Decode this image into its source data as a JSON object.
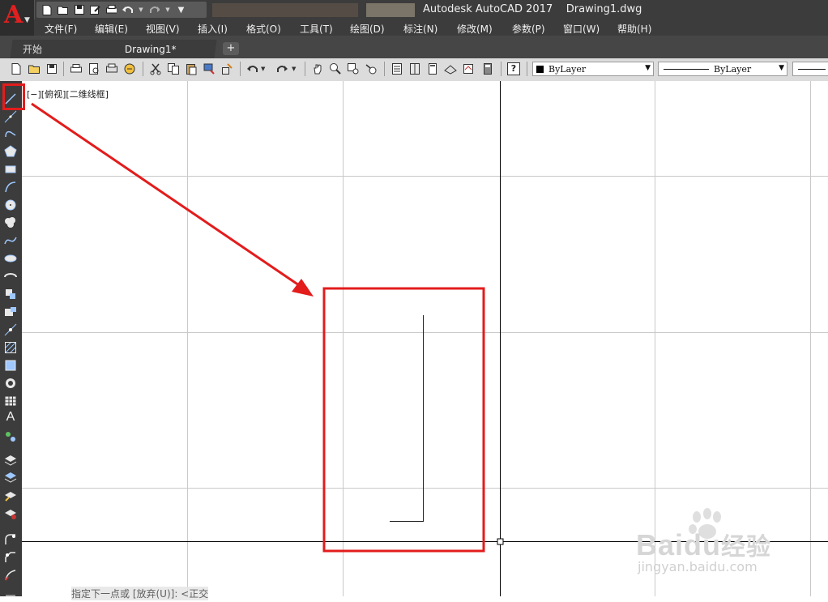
{
  "titlebar": {
    "app_name": "Autodesk AutoCAD 2017",
    "document": "Drawing1.dwg",
    "app_logo_letter": "A",
    "qat_icons": [
      "new-icon",
      "open-icon",
      "save-icon",
      "save-as-icon",
      "plot-icon",
      "undo-icon",
      "redo-icon",
      "customize-icon"
    ]
  },
  "menu": {
    "items": [
      "文件(F)",
      "编辑(E)",
      "视图(V)",
      "插入(I)",
      "格式(O)",
      "工具(T)",
      "绘图(D)",
      "标注(N)",
      "修改(M)",
      "参数(P)",
      "窗口(W)",
      "帮助(H)"
    ]
  },
  "tabs": {
    "start": "开始",
    "drawing": "Drawing1*",
    "add": "+"
  },
  "toolbar": {
    "color_dropdown": "ByLayer",
    "linetype_dropdown": "ByLayer",
    "help_label": "?"
  },
  "canvas": {
    "viewport_label": "[−][俯视][二维线框]",
    "command_prompt": "指定下一点或 [放弃(U)]: <正交",
    "background": "#ffffff",
    "grid_color": "#c9c9c9",
    "axis_color": "#000000",
    "annotation_color": "#e31c1c"
  },
  "left_toolbar": {
    "icons": [
      "line-icon",
      "construction-line-icon",
      "polyline-icon",
      "polygon-icon",
      "rectangle-icon",
      "arc-icon",
      "circle-icon",
      "revision-cloud-icon",
      "spline-icon",
      "ellipse-icon",
      "ellipse-arc-icon",
      "insert-block-icon",
      "make-block-icon",
      "point-icon",
      "hatch-icon",
      "gradient-icon",
      "region-icon",
      "table-icon",
      "multiline-text-icon",
      "add-selected-icon"
    ]
  },
  "watermark": {
    "brand": "Baidu",
    "suffix": "经验",
    "url": "jingyan.baidu.com"
  }
}
